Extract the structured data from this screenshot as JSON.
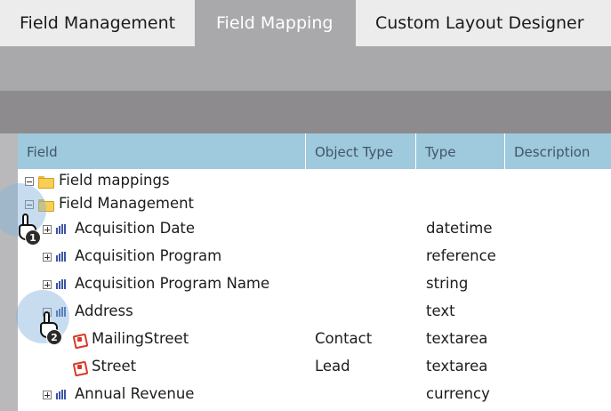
{
  "tabs": [
    {
      "label": "Field Management",
      "active": false
    },
    {
      "label": "Field Mapping",
      "active": true
    },
    {
      "label": "Custom Layout Designer",
      "active": false
    }
  ],
  "grid": {
    "columns": [
      "Field",
      "Object Type",
      "Type",
      "Description"
    ],
    "rows": [
      {
        "label": "Field mappings",
        "kind": "folder",
        "expanded": true,
        "object_type": "",
        "type": ""
      },
      {
        "label": "Field Management",
        "kind": "folder",
        "expanded": true,
        "object_type": "",
        "type": ""
      },
      {
        "label": "Acquisition Date",
        "kind": "field",
        "expanded": false,
        "object_type": "",
        "type": "datetime"
      },
      {
        "label": "Acquisition Program",
        "kind": "field",
        "expanded": false,
        "object_type": "",
        "type": "reference"
      },
      {
        "label": "Acquisition Program Name",
        "kind": "field",
        "expanded": false,
        "object_type": "",
        "type": "string"
      },
      {
        "label": "Address",
        "kind": "field",
        "expanded": true,
        "object_type": "",
        "type": "text"
      },
      {
        "label": "MailingStreet",
        "kind": "mapped-field",
        "object_type": "Contact",
        "type": "textarea"
      },
      {
        "label": "Street",
        "kind": "mapped-field",
        "object_type": "Lead",
        "type": "textarea"
      },
      {
        "label": "Annual Revenue",
        "kind": "field",
        "expanded": false,
        "object_type": "",
        "type": "currency"
      }
    ]
  },
  "annotations": [
    {
      "number": "1"
    },
    {
      "number": "2"
    }
  ],
  "icons": {
    "folder": "folder-icon",
    "field": "bar-field-icon",
    "mapped-field": "salesforce-field-icon"
  },
  "colors": {
    "header_bg": "#9fc9dc",
    "active_tab_bg": "#a9a8aa",
    "band_dark": "#8d8b8e"
  }
}
